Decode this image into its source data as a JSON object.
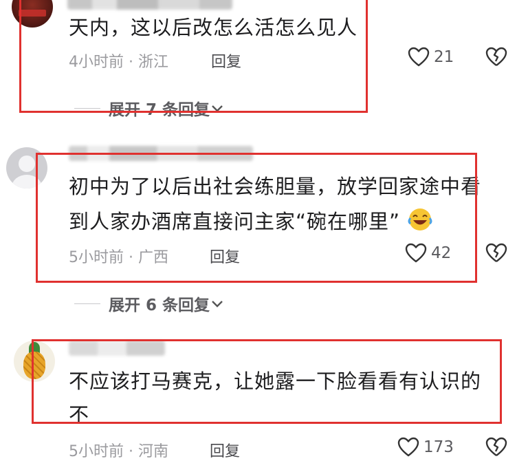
{
  "comments": [
    {
      "text_lines": [
        "天内，这以后改怎么活怎么见人"
      ],
      "time": "4小时前",
      "location": "浙江",
      "reply_label": "回复",
      "likes": "21",
      "expand_label": "展开 7 条回复"
    },
    {
      "text_lines": [
        "初中为了以后出社会练胆量，放学回家途中看",
        "到人家办酒席直接问主家“碗在哪里”"
      ],
      "time": "5小时前",
      "location": "广西",
      "reply_label": "回复",
      "likes": "42",
      "expand_label": "展开 6 条回复"
    },
    {
      "text_lines": [
        "不应该打马赛克，让她露一下脸看看有认识的",
        "不"
      ],
      "time": "5小时前",
      "location": "河南",
      "reply_label": "回复",
      "likes": "173"
    }
  ],
  "separator": "·",
  "icons": [
    "heart-icon",
    "broken-heart-icon",
    "chevron-down-icon",
    "laughing-emoji-icon"
  ],
  "colors": {
    "highlight_box": "#e0312f",
    "meta_text": "#9a9a9e"
  }
}
